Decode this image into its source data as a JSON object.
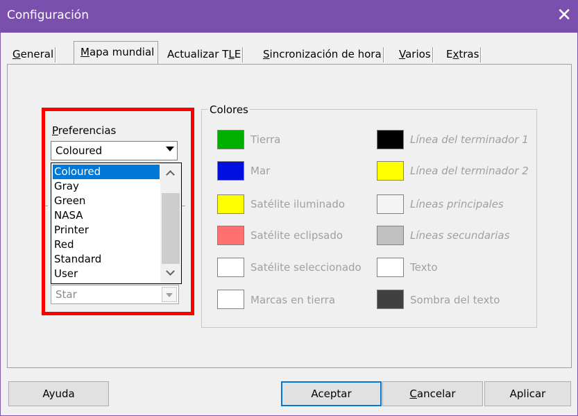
{
  "window": {
    "title": "Configuración",
    "close_glyph": "✕"
  },
  "tabs": [
    {
      "label": "General",
      "active": false
    },
    {
      "label": "Mapa mundial",
      "active": true
    },
    {
      "label": "Actualizar TLE",
      "active": false
    },
    {
      "label": "Sincronización de hora",
      "active": false
    },
    {
      "label": "Varios",
      "active": false
    },
    {
      "label": "Extras",
      "active": false
    }
  ],
  "preferences": {
    "label": "Preferencias",
    "selected": "Coloured",
    "options": [
      "Coloured",
      "Gray",
      "Green",
      "NASA",
      "Printer",
      "Red",
      "Standard",
      "User"
    ],
    "second_combo_value": "Star"
  },
  "colors_group": {
    "label": "Colores",
    "items": [
      {
        "label": "Tierra",
        "color": "#00b000"
      },
      {
        "label": "Mar",
        "color": "#0010e0"
      },
      {
        "label": "Satélite iluminado",
        "color": "#ffff00"
      },
      {
        "label": "Satélite eclipsado",
        "color": "#ff7070"
      },
      {
        "label": "Satélite seleccionado",
        "color": "#ffffff"
      },
      {
        "label": "Marcas en tierra",
        "color": "#ffffff"
      },
      {
        "label": "Línea del terminador 1",
        "color": "#000000"
      },
      {
        "label": "Línea del terminador 2",
        "color": "#ffff00"
      },
      {
        "label": "Líneas principales",
        "color": "#f4f4f4"
      },
      {
        "label": "Líneas secundarias",
        "color": "#c0c0c0"
      },
      {
        "label": "Texto",
        "color": "#ffffff"
      },
      {
        "label": "Sombra del texto",
        "color": "#404040"
      }
    ]
  },
  "buttons": {
    "help": "Ayuda",
    "ok": "Aceptar",
    "cancel": "Cancelar",
    "apply": "Aplicar"
  },
  "accent": "#7a4fae",
  "highlight": "#ff0000"
}
